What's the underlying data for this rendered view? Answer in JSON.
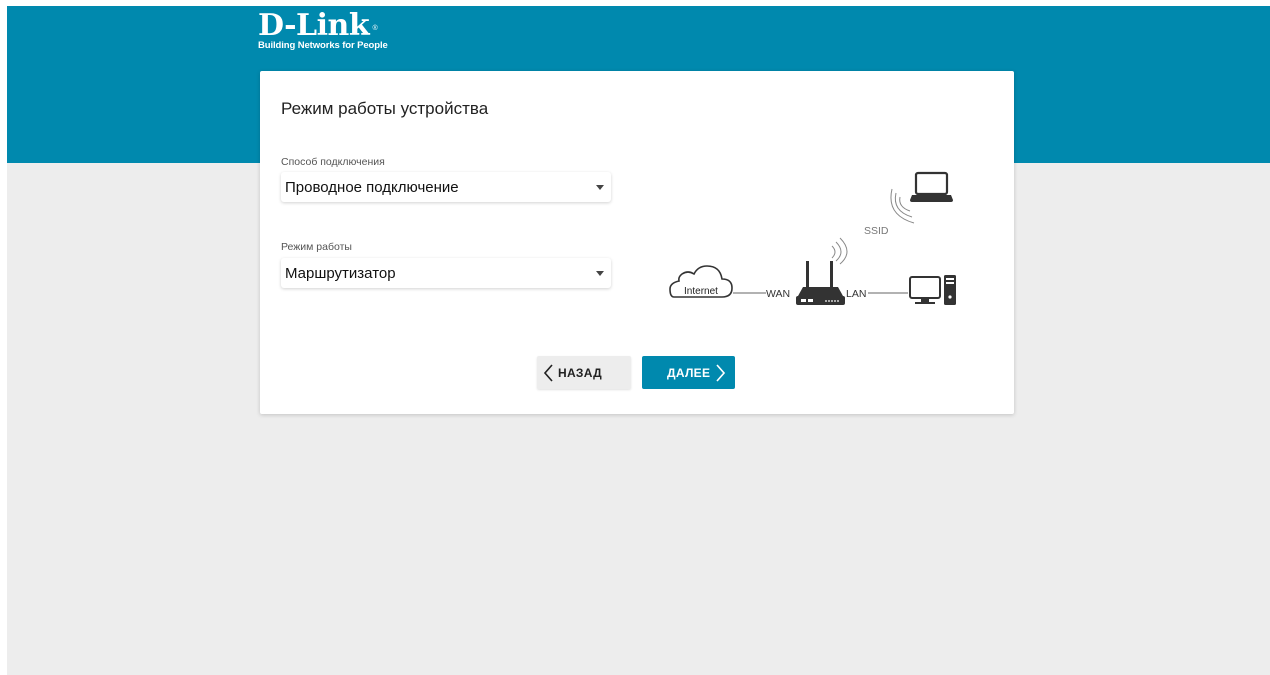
{
  "brand": {
    "logo_text": "D-Link",
    "registered_mark": "®",
    "tagline": "Building Networks for People"
  },
  "page": {
    "title": "Режим работы устройства"
  },
  "form": {
    "connection": {
      "label": "Способ подключения",
      "value": "Проводное подключение"
    },
    "mode": {
      "label": "Режим работы",
      "value": "Маршрутизатор"
    }
  },
  "diagram": {
    "internet": "Internet",
    "wan": "WAN",
    "lan": "LAN",
    "ssid": "SSID"
  },
  "buttons": {
    "back_label": "НАЗАД",
    "next_label": "ДАЛЕЕ"
  },
  "colors": {
    "accent": "#0089ae",
    "background": "#ededed",
    "card": "#ffffff",
    "diagram_stroke": "#333333"
  },
  "icons": [
    "chevron-left-icon",
    "chevron-right-icon",
    "caret-down-icon",
    "cloud-icon",
    "router-icon",
    "laptop-icon",
    "desktop-icon",
    "wifi-icon"
  ]
}
